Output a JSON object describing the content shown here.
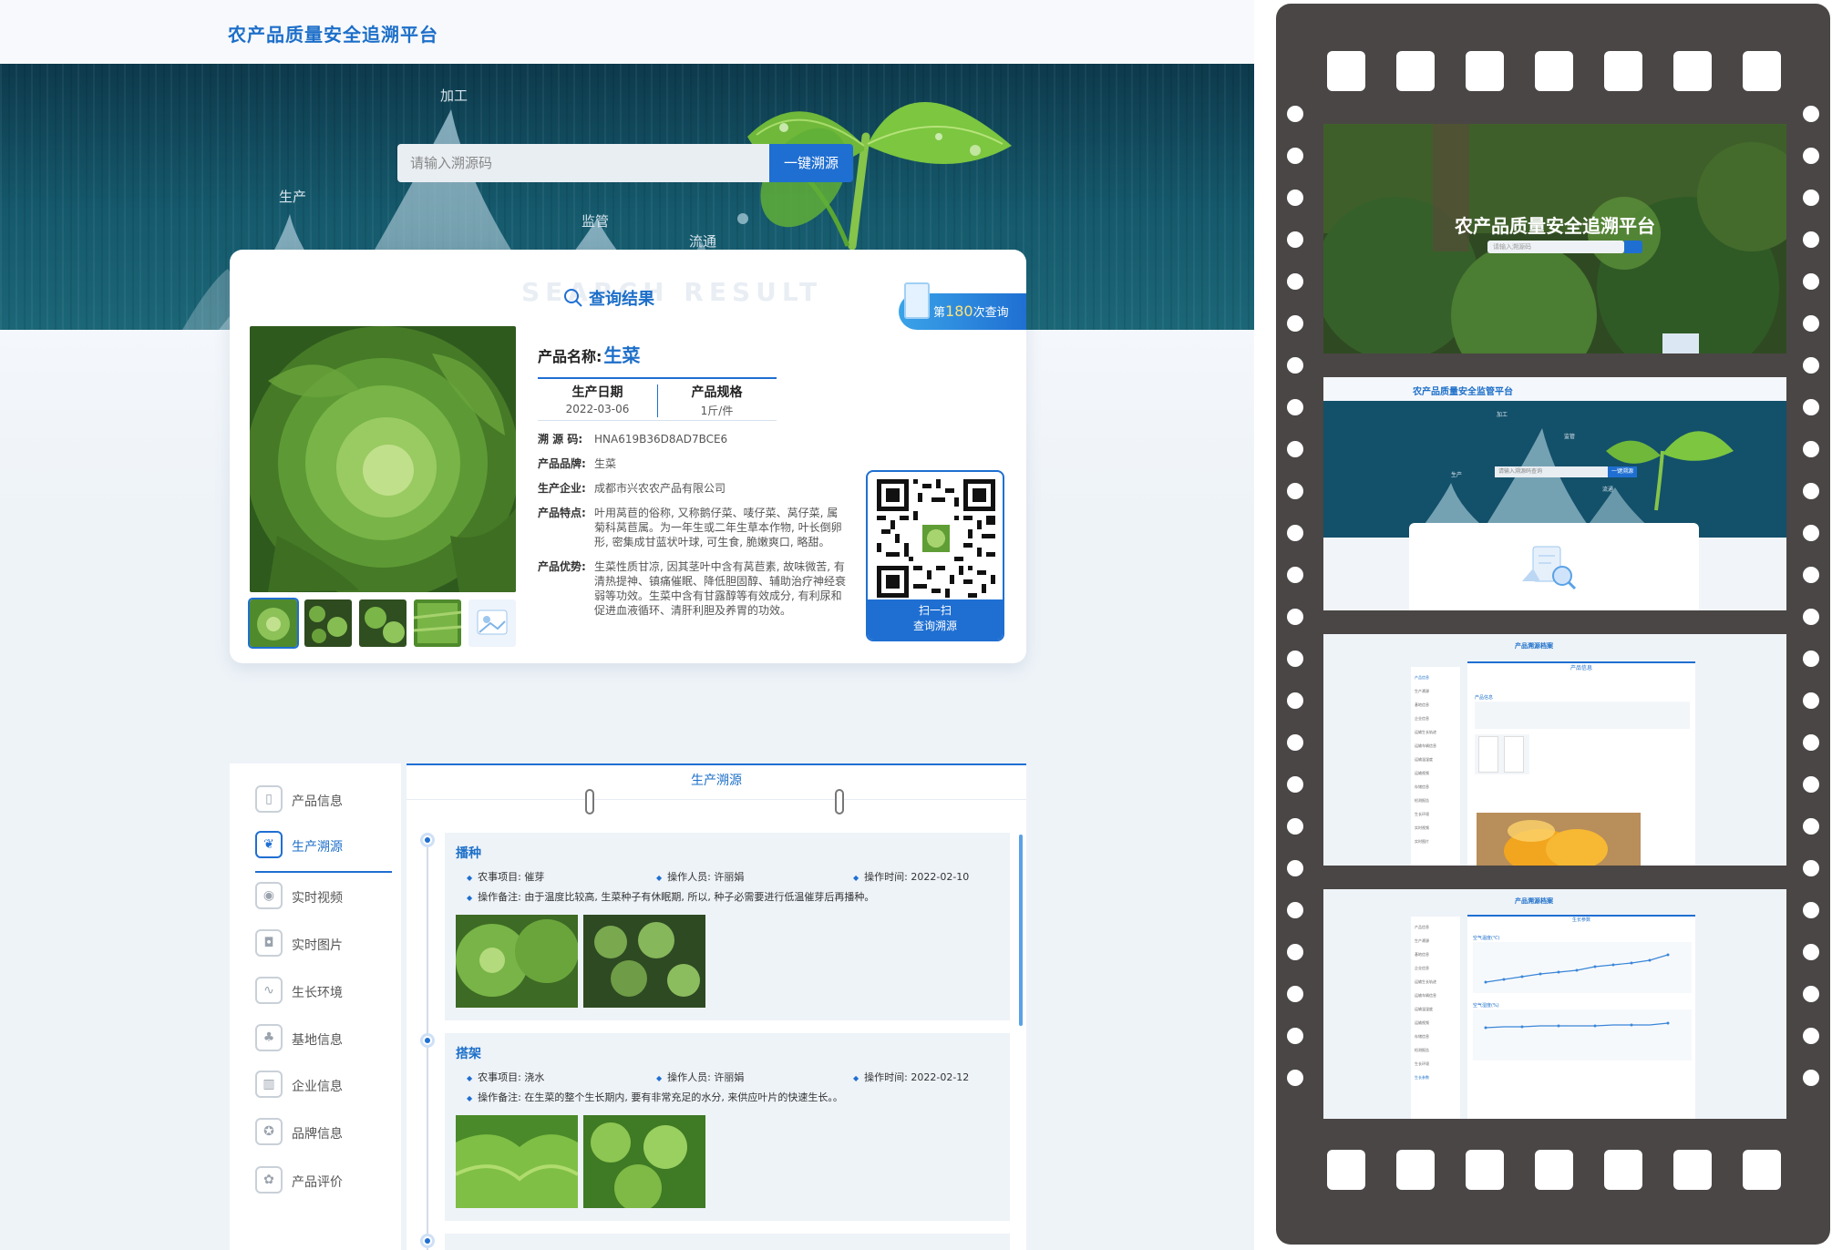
{
  "app": {
    "title": "农产品质量安全追溯平台"
  },
  "banner": {
    "tags": [
      "加工",
      "生产",
      "监管",
      "流通"
    ]
  },
  "search": {
    "placeholder": "请输入溯源码",
    "button": "一键溯源"
  },
  "result": {
    "watermark": "SEARCH RESULT",
    "title": "查询结果",
    "badge_prefix": "第",
    "badge_count": "180",
    "badge_suffix": "次查询",
    "product_name_label": "产品名称:",
    "product_name": "生菜",
    "specs": [
      {
        "label": "生产日期",
        "value": "2022-03-06"
      },
      {
        "label": "产品规格",
        "value": "1斤/件"
      }
    ],
    "fields": [
      {
        "label": "溯 源 码:",
        "value": "HNA619B36D8AD7BCE6"
      },
      {
        "label": "产品品牌:",
        "value": "生菜"
      },
      {
        "label": "生产企业:",
        "value": "成都市兴农农产品有限公司"
      },
      {
        "label": "产品特点:",
        "value": "叶用莴苣的俗称, 又称鹅仔菜、唛仔菜、莴仔菜, 属菊科莴苣属。为一年生或二年生草本作物, 叶长倒卵形, 密集成甘蓝状叶球, 可生食, 脆嫩爽口, 略甜。"
      },
      {
        "label": "产品优势:",
        "value": "生菜性质甘凉, 因其茎叶中含有莴苣素, 故味微苦, 有清热提神、镇痛催眠、降低胆固醇、辅助治疗神经衰弱等功效。生菜中含有甘露醇等有效成分, 有利尿和促进血液循环、清肝利胆及养胃的功效。"
      }
    ],
    "qr_caption": [
      "扫一扫",
      "查询溯源"
    ]
  },
  "sidebar": {
    "items": [
      {
        "label": "产品信息",
        "icon": "book-icon"
      },
      {
        "label": "生产溯源",
        "icon": "leaf-icon",
        "active": true
      },
      {
        "label": "实时视频",
        "icon": "camera-icon"
      },
      {
        "label": "实时图片",
        "icon": "photo-icon"
      },
      {
        "label": "生长环境",
        "icon": "chart-icon"
      },
      {
        "label": "基地信息",
        "icon": "sprout-icon"
      },
      {
        "label": "企业信息",
        "icon": "building-icon"
      },
      {
        "label": "品牌信息",
        "icon": "medal-icon"
      },
      {
        "label": "产品评价",
        "icon": "hands-icon"
      }
    ]
  },
  "production": {
    "tab": "生产溯源",
    "entries": [
      {
        "title": "播种",
        "item": "农事项目: 催芽",
        "operator": "操作人员: 许丽娟",
        "time": "操作时间: 2022-02-10",
        "note": "操作备注: 由于温度比较高, 生菜种子有休眠期, 所以, 种子必需要进行低温催芽后再播种。"
      },
      {
        "title": "搭架",
        "item": "农事项目: 浇水",
        "operator": "操作人员: 许丽娟",
        "time": "操作时间: 2022-02-12",
        "note": "操作备注: 在生菜的整个生长期内, 要有非常充足的水分, 来供应叶片的快速生长。。"
      }
    ]
  },
  "film": {
    "frame1_title": "农产品质量安全追溯平台",
    "frame1_placeholder": "请输入溯源码",
    "frame2_title": "农产品质量安全监管平台",
    "frame2_tags": [
      "加工",
      "生产",
      "监管",
      "流通"
    ],
    "frame2_placeholder": "请输入溯源码查询",
    "frame2_button": "一键溯源",
    "frame3_header": "产品溯源档案",
    "frame3_tab": "产品信息",
    "frame3_section": "产品信息",
    "frame3_side": [
      "产品信息",
      "生产溯源",
      "基地信息",
      "企业信息",
      "运输生长轨迹",
      "运输车辆信息",
      "运输温湿度",
      "运输视频",
      "存储信息",
      "检测报告",
      "生长环境",
      "实时视频",
      "实时图片"
    ],
    "frame4_header": "产品溯源档案",
    "frame4_tab": "生长参数",
    "frame4_chart1_title": "空气温度(℃)",
    "frame4_chart2_title": "空气湿度(%)",
    "frame4_side": [
      "产品信息",
      "生产溯源",
      "基地信息",
      "企业信息",
      "运输生长轨迹",
      "运输车辆信息",
      "运输温湿度",
      "运输视频",
      "存储信息",
      "检测报告",
      "生长环境",
      "生长参数"
    ]
  },
  "colors": {
    "accent": "#1f6fd2",
    "title": "#1d6fc9",
    "film": "#4a4645"
  }
}
